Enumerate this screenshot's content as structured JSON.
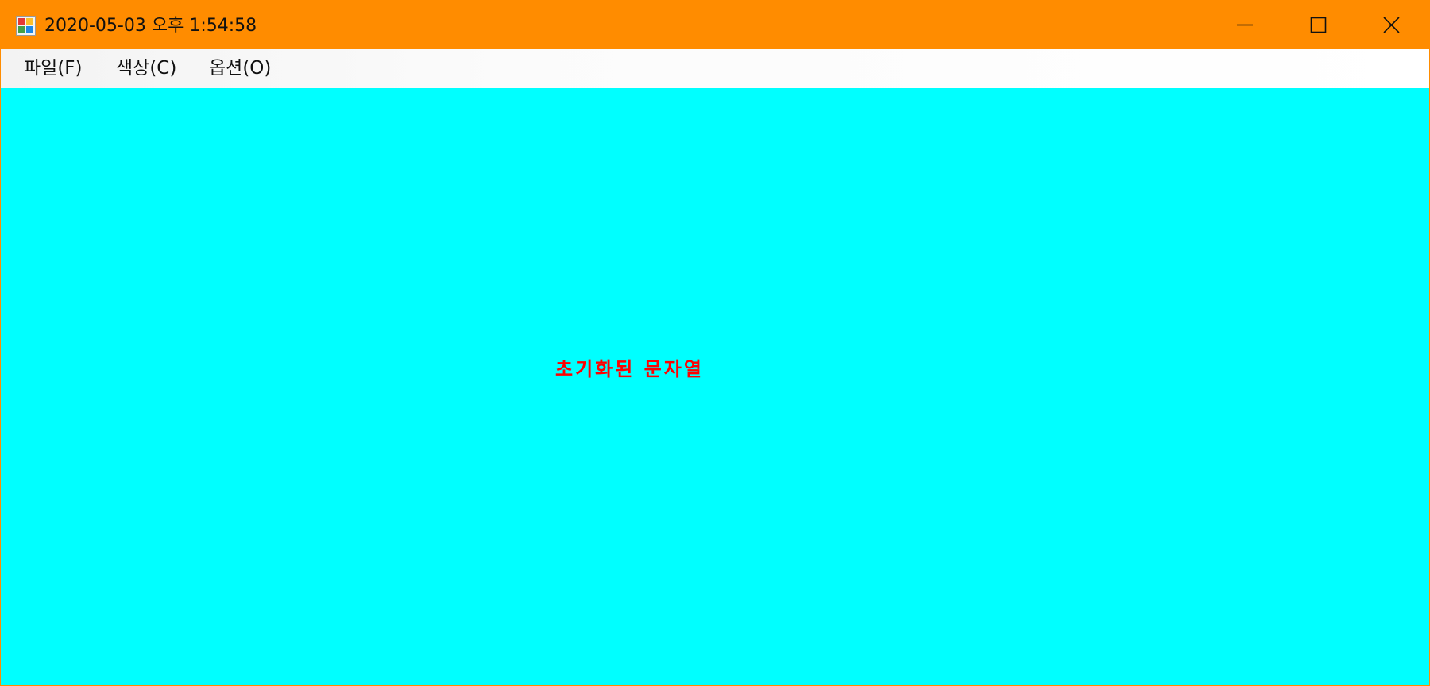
{
  "window": {
    "title": "2020-05-03 오후 1:54:58",
    "colors": {
      "titlebar": "#ff8c00",
      "client_background": "#00ffff",
      "text": "#ff0000"
    }
  },
  "titlebar": {
    "icon": "app-window-icon",
    "controls": {
      "minimize_icon": "minimize-icon",
      "maximize_icon": "maximize-icon",
      "close_icon": "close-icon"
    }
  },
  "menubar": {
    "items": [
      {
        "label": "파일(F)"
      },
      {
        "label": "색상(C)"
      },
      {
        "label": "옵션(O)"
      }
    ]
  },
  "content": {
    "text": "초기화된 문자열"
  }
}
